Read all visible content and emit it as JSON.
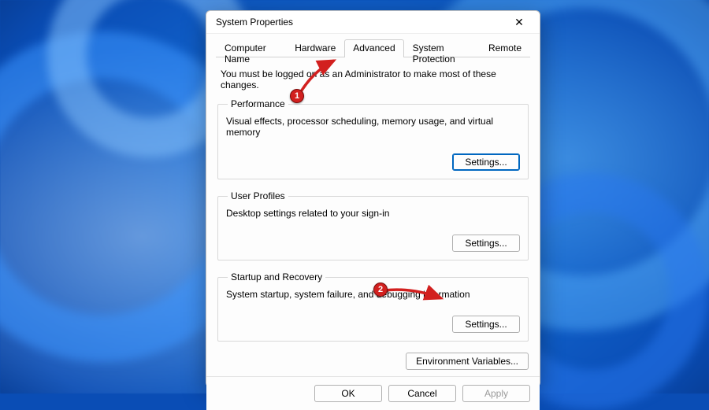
{
  "window": {
    "title": "System Properties"
  },
  "tabs": {
    "computer_name": "Computer Name",
    "hardware": "Hardware",
    "advanced": "Advanced",
    "system_protection": "System Protection",
    "remote": "Remote"
  },
  "info_line": "You must be logged on as an Administrator to make most of these changes.",
  "groups": {
    "performance": {
      "legend": "Performance",
      "desc": "Visual effects, processor scheduling, memory usage, and virtual memory",
      "button": "Settings..."
    },
    "user_profiles": {
      "legend": "User Profiles",
      "desc": "Desktop settings related to your sign-in",
      "button": "Settings..."
    },
    "startup": {
      "legend": "Startup and Recovery",
      "desc": "System startup, system failure, and debugging information",
      "button": "Settings..."
    }
  },
  "env_button": "Environment Variables...",
  "footer": {
    "ok": "OK",
    "cancel": "Cancel",
    "apply": "Apply"
  },
  "annotations": {
    "badge1": "1",
    "badge2": "2"
  }
}
